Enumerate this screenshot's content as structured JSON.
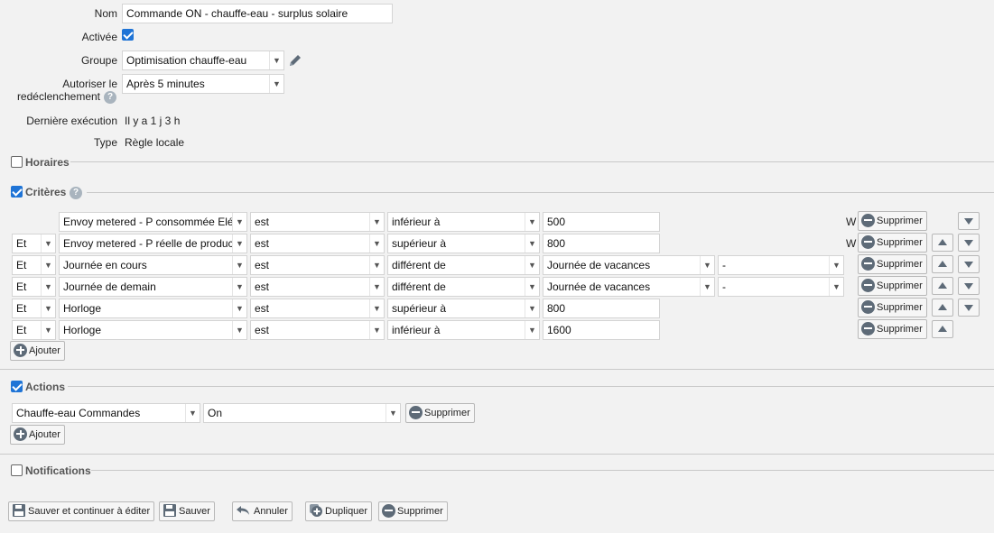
{
  "form": {
    "name_label": "Nom",
    "name_value": "Commande ON - chauffe-eau - surplus solaire",
    "enabled_label": "Activée",
    "group_label": "Groupe",
    "group_value": "Optimisation chauffe-eau",
    "retrigger_label_1": "Autoriser le",
    "retrigger_label_2": "redéclenchement",
    "retrigger_value": "Après 5 minutes",
    "last_exec_label": "Dernière exécution",
    "last_exec_value": "Il y a 1 j 3 h",
    "type_label": "Type",
    "type_value": "Règle locale"
  },
  "sections": {
    "schedules": "Horaires",
    "criteria": "Critères",
    "actions": "Actions",
    "notifications": "Notifications"
  },
  "criteria": [
    {
      "conj": "",
      "device": "Envoy metered - P consommée Elé",
      "verb": "est",
      "op": "inférieur à",
      "value": "500",
      "unit": "W"
    },
    {
      "conj": "Et",
      "device": "Envoy metered - P réelle de produc",
      "verb": "est",
      "op": "supérieur à",
      "value": "800",
      "unit": "W"
    },
    {
      "conj": "Et",
      "device": "Journée en cours",
      "verb": "est",
      "op": "différent de",
      "value": "Journée de vacances",
      "extra": "-"
    },
    {
      "conj": "Et",
      "device": "Journée de demain",
      "verb": "est",
      "op": "différent de",
      "value": "Journée de vacances",
      "extra": "-"
    },
    {
      "conj": "Et",
      "device": "Horloge",
      "verb": "est",
      "op": "supérieur à",
      "value": "800"
    },
    {
      "conj": "Et",
      "device": "Horloge",
      "verb": "est",
      "op": "inférieur à",
      "value": "1600"
    }
  ],
  "action_row": {
    "device": "Chauffe-eau Commandes",
    "command": "On"
  },
  "buttons": {
    "delete": "Supprimer",
    "add": "Ajouter",
    "save_continue": "Sauver et continuer à éditer",
    "save": "Sauver",
    "cancel": "Annuler",
    "duplicate": "Dupliquer",
    "delete_rule": "Supprimer"
  },
  "colors": {
    "checkbox": "#1f74d6",
    "icon": "#5e6b78",
    "background": "#f2f2f2"
  }
}
